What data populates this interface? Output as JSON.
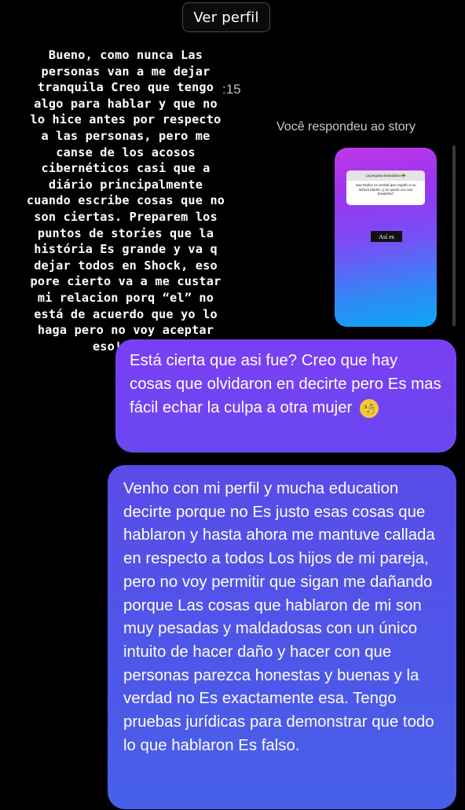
{
  "header": {
    "view_profile_label": "Ver perfil"
  },
  "story_overlay_text": "Bueno, como nunca Las\npersonas van a me dejar\ntranquila Creo que tengo\nalgo para hablar y que no\nlo hice antes por respecto\na las personas, pero me\ncanse de los acosos\ncibernéticos casi que a\ndiário principalmente\ncuando escribe cosas que no\nson ciertas. Preparem los\npuntos de stories que la\nhistória Es grande y va q\ndejar todos en Shock, eso\npore cierto va a me custar\nmi relacion porq “el” no\nestá de acuerdo que yo lo\nhaga pero no voy aceptar\neso!!!!!!",
  "timestamp": ":15",
  "replied_label": "Você respondeu ao story",
  "story_preview": {
    "question_header": "La pregunta farandulera 😎",
    "question_text": "Ivan Nuñez es verdad que engaño a su señora Marlén, y se quedó con una brasileña?",
    "answer": "Así es"
  },
  "messages": [
    {
      "text": "Está cierta que asi fue? Creo que hay cosas que olvidaron en decirte pero Es mas fácil echar la culpa a otra mujer",
      "emoji_icon": "face-with-monocle-icon",
      "emoji_glyph": "🧐"
    },
    {
      "text": "Venho con mi perfil y mucha education decirte porque no Es justo esas cosas que hablaron y hasta ahora me mantuve callada en respecto a todos Los hijos de mi pareja, pero no voy permitir que sigan me dañando porque Las cosas que hablaron de mi son muy pesadas y maldadosas con un único intuito de hacer daño y hacer con que personas parezca honestas y buenas y la verdad no Es exactamente esa. Tengo pruebas jurídicas para demonstrar que todo lo que hablaron Es falso."
    }
  ],
  "colors": {
    "background": "#000000",
    "bubble_top": "#7b3ff3",
    "bubble_bottom": "#4760e9"
  }
}
